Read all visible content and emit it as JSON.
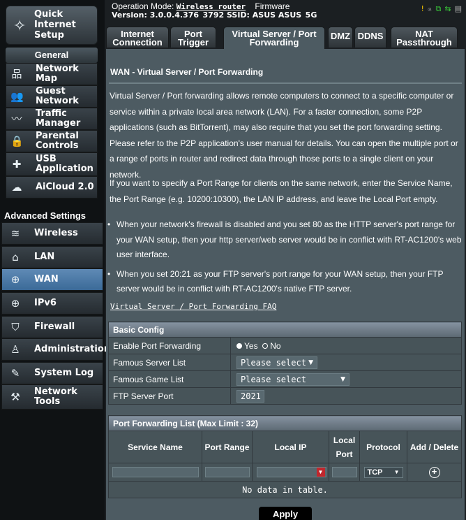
{
  "sidebar": {
    "quick_setup": "Quick Internet Setup",
    "general_label": "General",
    "general_items": [
      {
        "label": "Network Map",
        "icon": "network-map-icon"
      },
      {
        "label": "Guest Network",
        "icon": "guest-network-icon"
      },
      {
        "label": "Traffic Manager",
        "icon": "traffic-manager-icon"
      },
      {
        "label": "Parental Controls",
        "icon": "lock-icon"
      },
      {
        "label": "USB Application",
        "icon": "puzzle-icon"
      },
      {
        "label": "AiCloud 2.0",
        "icon": "cloud-icon"
      }
    ],
    "advanced_label": "Advanced Settings",
    "advanced_items": [
      {
        "label": "Wireless",
        "icon": "wifi-icon"
      },
      {
        "label": "LAN",
        "icon": "home-icon"
      },
      {
        "label": "WAN",
        "icon": "globe-icon",
        "active": true
      },
      {
        "label": "IPv6",
        "icon": "ipv6-globe-icon"
      },
      {
        "label": "Firewall",
        "icon": "shield-icon"
      },
      {
        "label": "Administration",
        "icon": "user-icon"
      },
      {
        "label": "System Log",
        "icon": "edit-log-icon"
      },
      {
        "label": "Network Tools",
        "icon": "tools-icon"
      }
    ]
  },
  "header": {
    "op_mode_label": "Operation Mode:",
    "op_mode_value": "Wireless router",
    "firmware_label": "Firmware",
    "version_line": "Version: 3.0.0.4.376_3792   SSID: ASUS  ASUS_5G"
  },
  "tabs": [
    "Internet Connection",
    "Port Trigger",
    "Virtual Server / Port Forwarding",
    "DMZ",
    "DDNS",
    "NAT Passthrough"
  ],
  "main": {
    "title": "WAN - Virtual Server / Port Forwarding",
    "description_1": "Virtual Server / Port forwarding allows remote computers to connect to a specific computer or service within a private local area network (LAN). For a faster connection, some P2P applications (such as BitTorrent), may also require that you set the port forwarding setting. Please refer to the P2P application's user manual for details. You can open the multiple port or a range of ports in router and redirect data through those ports to a single client on your network.",
    "description_2": "If you want to specify a Port Range for clients on the same network, enter the Service Name, the Port Range (e.g. 10200:10300), the LAN IP address, and leave the Local Port empty.",
    "bullets": [
      "When your network's firewall is disabled and you set 80 as the HTTP server's port range for your WAN setup, then your http server/web server would be in conflict with RT-AC1200's web user interface.",
      "When you set 20:21 as your FTP server's port range for your WAN setup, then your FTP server would be in conflict with RT-AC1200's native FTP server."
    ],
    "faq_link": "Virtual Server / Port Forwarding FAQ"
  },
  "basic_config": {
    "header": "Basic Config",
    "enable_label": "Enable Port Forwarding",
    "yes": "Yes",
    "no": "No",
    "famous_server_label": "Famous Server List",
    "famous_server_value": "Please select",
    "famous_game_label": "Famous Game List",
    "famous_game_value": "Please select",
    "ftp_port_label": "FTP Server Port",
    "ftp_port_value": "2021"
  },
  "pf_list": {
    "header": "Port Forwarding List (Max Limit : 32)",
    "columns": [
      "Service Name",
      "Port Range",
      "Local IP",
      "Local Port",
      "Protocol",
      "Add / Delete"
    ],
    "protocol_value": "TCP",
    "empty_text": "No data in table."
  },
  "apply_label": "Apply",
  "colors": {
    "content_bg": "#4d5b62",
    "active_menu": "#4f7aa8",
    "empty_text": "#ffcc00",
    "dropdown_red": "#c0272d"
  }
}
